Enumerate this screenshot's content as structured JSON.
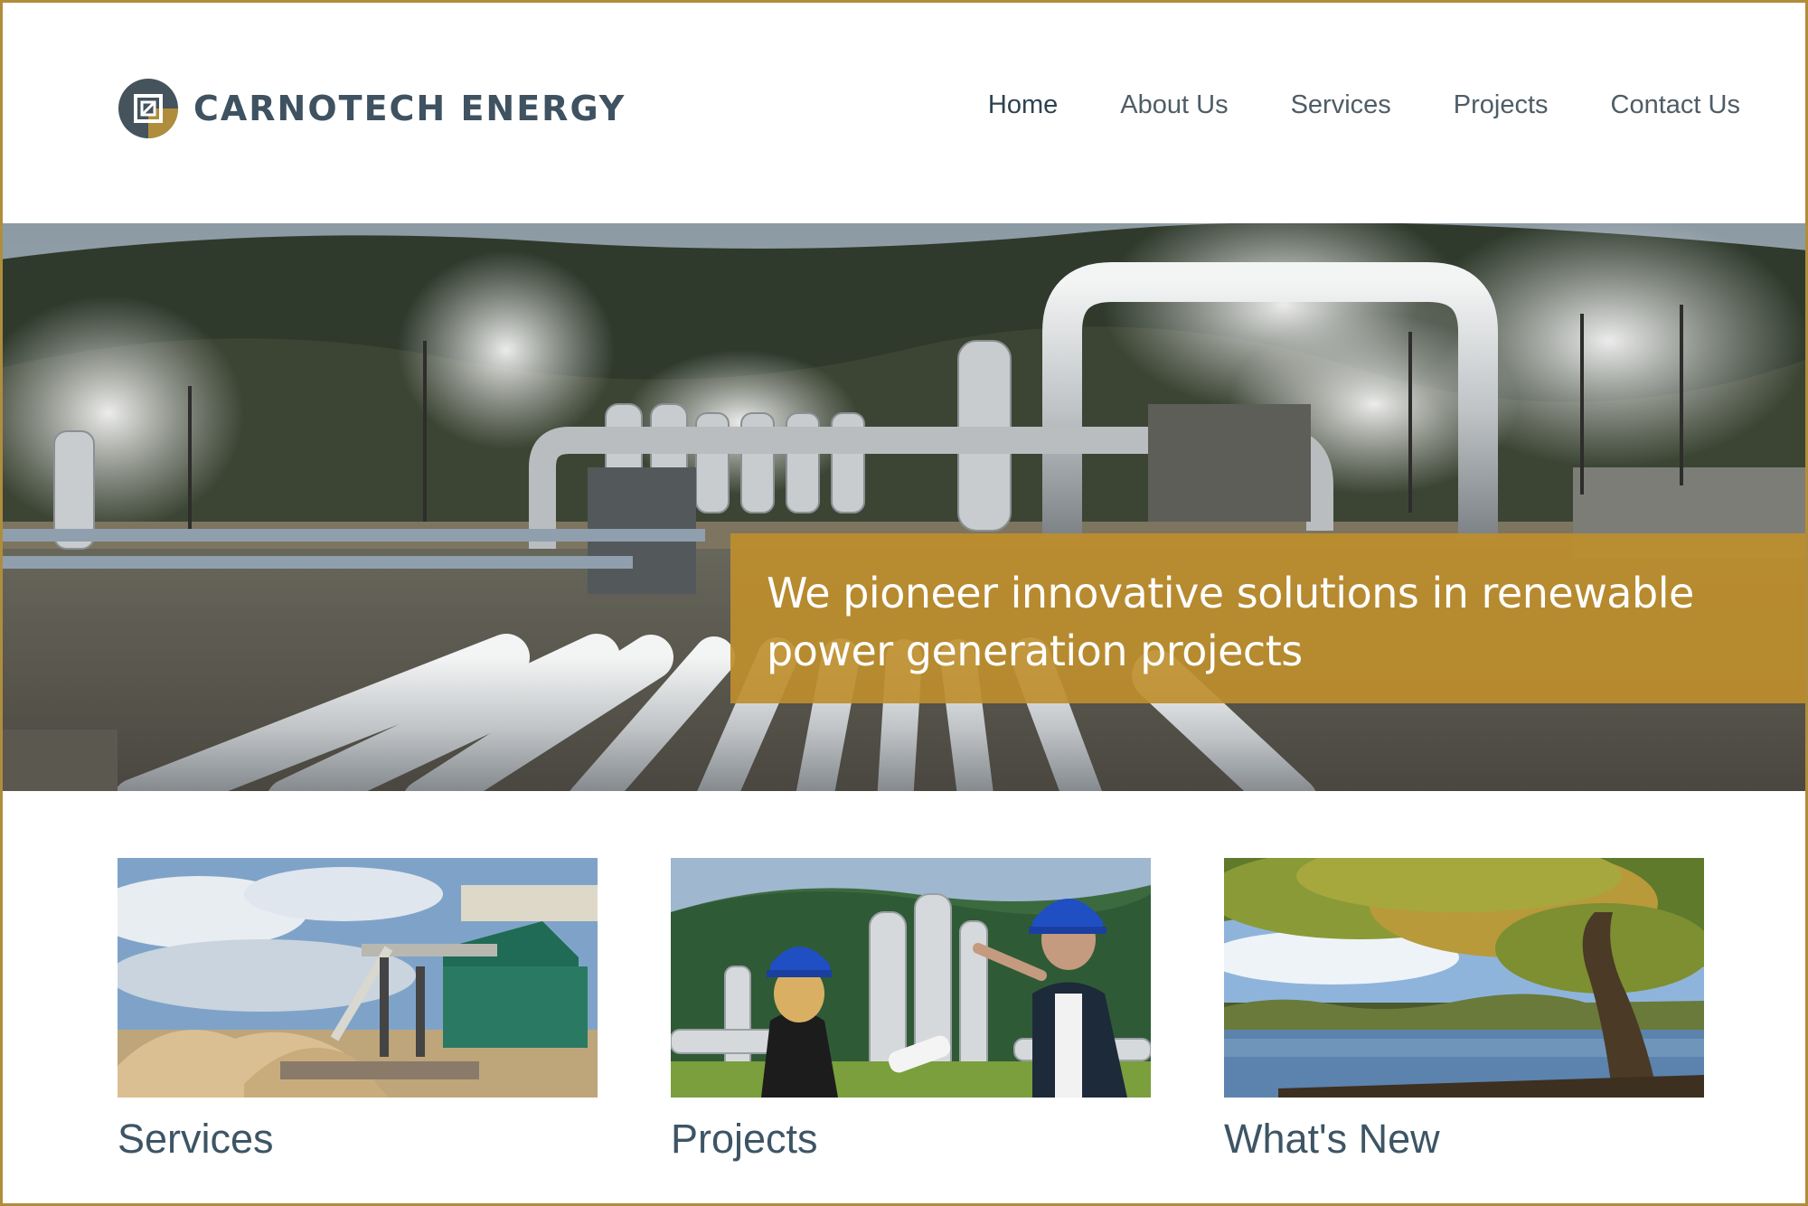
{
  "brand": {
    "name": "CARNOTECH ENERGY",
    "accent_color": "#b08d3c",
    "text_color": "#3f5261"
  },
  "nav": {
    "items": [
      {
        "label": "Home"
      },
      {
        "label": "About Us"
      },
      {
        "label": "Services"
      },
      {
        "label": "Projects"
      },
      {
        "label": "Contact Us"
      }
    ]
  },
  "hero": {
    "headline": "We pioneer innovative solutions in renewable power generation projects",
    "banner_color": "#be8e2c",
    "image": "geothermal-plant-photo"
  },
  "cards": [
    {
      "title": "Services",
      "image": "biomass-plant-photo"
    },
    {
      "title": "Projects",
      "image": "engineers-at-plant-photo"
    },
    {
      "title": "What's New",
      "image": "lake-tree-photo"
    }
  ]
}
